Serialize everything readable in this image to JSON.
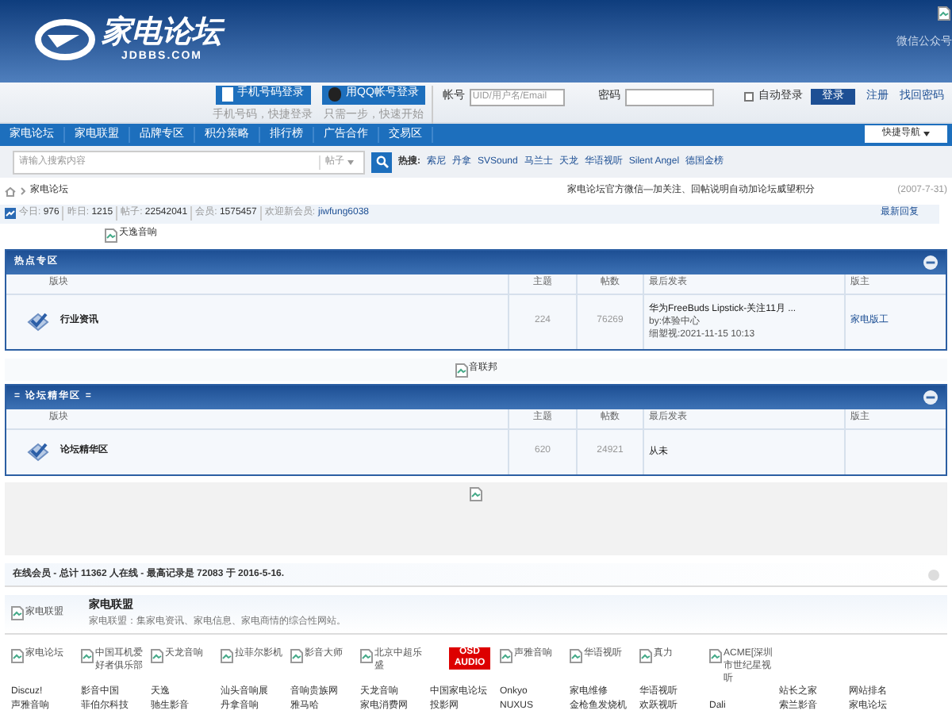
{
  "header": {
    "logo_text": "家电论坛",
    "logo_sub": "JDBBS.COM",
    "wechat_alt": "微信公众号"
  },
  "login": {
    "phone_button": "手机号码登录",
    "phone_hint": "手机号码，快捷登录",
    "qq_button": "用QQ帐号登录",
    "qq_hint": "只需一步，快速开始",
    "account_label": "帐号",
    "account_placeholder": "UID/用户名/Email",
    "password_label": "密码",
    "auto_login": {
      "label": "自动登录",
      "checked": false
    },
    "login_button": "登录",
    "register": "注册",
    "forgot": "找回密码"
  },
  "nav": {
    "items": [
      "家电论坛",
      "家电联盟",
      "品牌专区",
      "积分策略",
      "排行榜",
      "广告合作",
      "交易区"
    ],
    "quick_nav": "快捷导航"
  },
  "search": {
    "placeholder": "请输入搜索内容",
    "scope": "帖子",
    "hot_label": "热搜:",
    "hot": [
      "索尼",
      "丹拿",
      "SVSound",
      "马兰士",
      "天龙",
      "华语视听",
      "Silent Angel",
      "德国金榜"
    ]
  },
  "breadcrumb": {
    "current": "家电论坛",
    "notice": "家电论坛官方微信—加关注、回帖说明自动加论坛威望积分",
    "date": "(2007-7-31)"
  },
  "stats": {
    "items": [
      {
        "label": "今日:",
        "value": "976"
      },
      {
        "label": "昨日:",
        "value": "1215"
      },
      {
        "label": "帖子:",
        "value": "22542041"
      },
      {
        "label": "会员:",
        "value": "1575457"
      }
    ],
    "welcome": "欢迎新会员:",
    "new_member": "jiwfung6038",
    "latest": "最新回复"
  },
  "ad_top": "天逸音响",
  "sections": [
    {
      "title": "热点专区",
      "columns": [
        "版块",
        "主题",
        "帖数",
        "最后发表",
        "版主"
      ],
      "rows": [
        {
          "name": "行业资讯",
          "topics": "224",
          "posts": "76269",
          "last": [
            "华为FreeBuds Lipstick-关注11月 ...",
            "by:体验中心",
            "细塑视:2021-11-15 10:13"
          ],
          "moderator": "家电版工"
        }
      ]
    },
    {
      "title": "= 论坛精华区 =",
      "columns": [
        "版块",
        "主题",
        "帖数",
        "最后发表",
        "版主"
      ],
      "rows": [
        {
          "name": "论坛精华区",
          "topics": "620",
          "posts": "24921",
          "last": [
            "从未"
          ]
        }
      ]
    }
  ],
  "ad_middle": "音联邦",
  "online": "在线会员 - 总计 11362 人在线 - 最高记录是 72083 于 2016-5-16.",
  "alliance": {
    "logo_alt": "家电联盟",
    "title": "家电联盟",
    "description": "家电联盟：集家电资讯、家电信息、家电商情的综合性网站。"
  },
  "partner_logos": [
    {
      "kind": "alt",
      "text": "家电论坛"
    },
    {
      "kind": "alt",
      "text": "中国耳机爱好者俱乐部"
    },
    {
      "kind": "alt",
      "text": "天龙音响"
    },
    {
      "kind": "alt",
      "text": "拉菲尔影机"
    },
    {
      "kind": "alt",
      "text": "影音大师"
    },
    {
      "kind": "alt",
      "text": "北京中超乐盛"
    },
    {
      "kind": "logo",
      "text": "OSD AUDIO"
    },
    {
      "kind": "alt",
      "text": "声雅音响"
    },
    {
      "kind": "alt",
      "text": "华语视听"
    },
    {
      "kind": "alt",
      "text": "真力"
    },
    {
      "kind": "alt",
      "text": "ACME[深圳市世纪星视听"
    }
  ],
  "links": [
    [
      "Discuz!",
      "声雅音响"
    ],
    [
      "影音中国",
      "菲伯尔科技"
    ],
    [
      "天逸",
      "驰生影音"
    ],
    [
      "汕头音响展",
      "丹拿音响"
    ],
    [
      "音响贵族网",
      "雅马哈"
    ],
    [
      "天龙音响",
      "家电消费网"
    ],
    [
      "中国家电论坛",
      "投影网"
    ],
    [
      "Onkyo",
      "NUXUS"
    ],
    [
      "家电维修",
      "金枪鱼发烧机"
    ],
    [
      "华语视听",
      "欢跃视听"
    ],
    [
      "Dali"
    ],
    [
      "站长之家",
      "索兰影音"
    ],
    [
      "网站排名",
      "家电论坛"
    ]
  ]
}
